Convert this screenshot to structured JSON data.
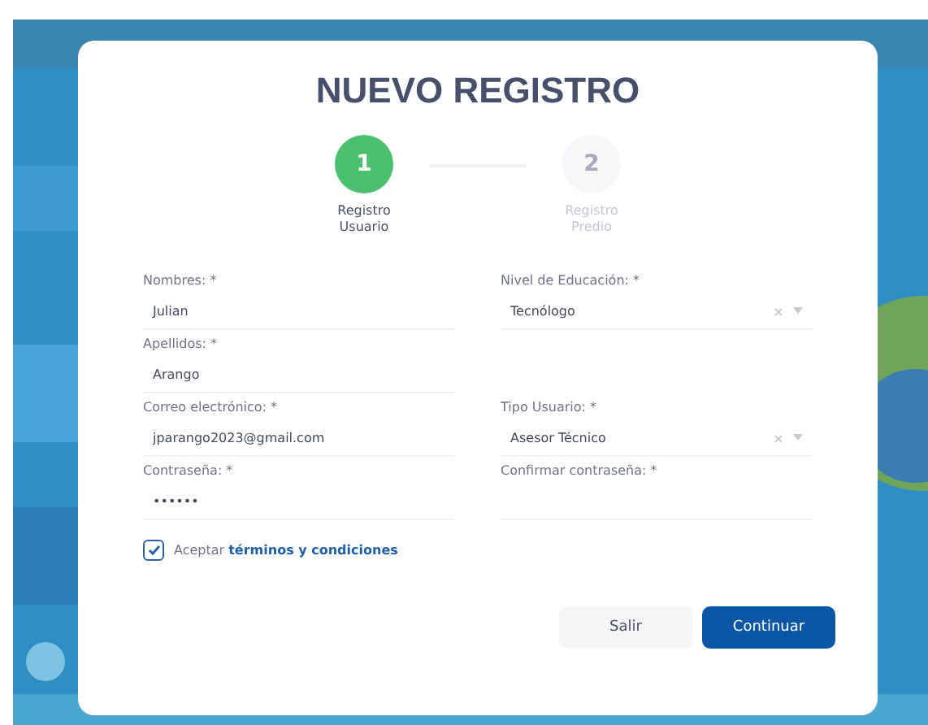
{
  "dialog": {
    "title": "NUEVO REGISTRO"
  },
  "steps": [
    {
      "number": "1",
      "label": "Registro Usuario",
      "selected": true
    },
    {
      "number": "2",
      "label": "Registro Predio",
      "selected": false
    }
  ],
  "fields": [
    {
      "label": "Nombres: *",
      "value": "Julian",
      "kind": "text"
    },
    {
      "label": "Nivel de Educación: *",
      "value": "Tecnólogo",
      "kind": "select"
    },
    {
      "label": "Apellidos: *",
      "value": "Arango",
      "kind": "text"
    },
    {
      "kind": "empty"
    },
    {
      "label": "Correo electrónico: *",
      "value": "jparango2023@gmail.com",
      "kind": "text"
    },
    {
      "label": "Tipo Usuario: *",
      "value": "Asesor Técnico",
      "kind": "select"
    },
    {
      "label": "Contraseña: *",
      "value": "••••••",
      "kind": "text"
    },
    {
      "label": "Confirmar contraseña: *",
      "kind": "text"
    }
  ],
  "terms": {
    "checked": true,
    "text": "Aceptar",
    "link": "términos y condiciones"
  },
  "buttons": [
    {
      "label": "Salir",
      "kind": "secondary"
    },
    {
      "label": "Continuar",
      "kind": "primary"
    }
  ]
}
